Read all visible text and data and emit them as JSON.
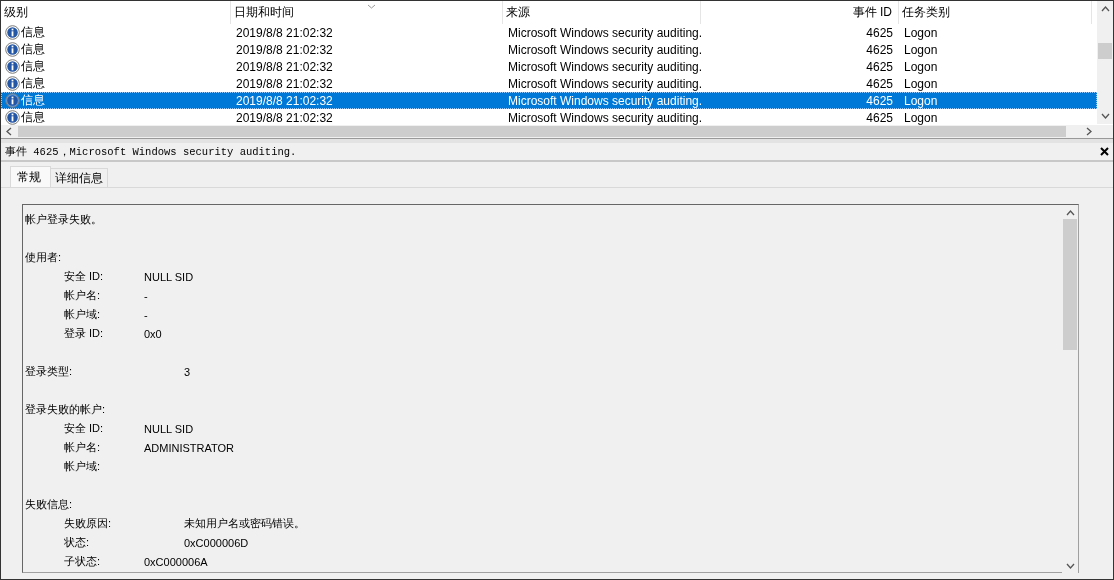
{
  "events": {
    "columns": [
      "级别",
      "日期和时间",
      "来源",
      "事件 ID",
      "任务类别"
    ],
    "rows": [
      {
        "level": "信息",
        "date": "2019/8/8 21:02:32",
        "source": "Microsoft Windows security auditing.",
        "event_id": "4625",
        "category": "Logon",
        "selected": false
      },
      {
        "level": "信息",
        "date": "2019/8/8 21:02:32",
        "source": "Microsoft Windows security auditing.",
        "event_id": "4625",
        "category": "Logon",
        "selected": false
      },
      {
        "level": "信息",
        "date": "2019/8/8 21:02:32",
        "source": "Microsoft Windows security auditing.",
        "event_id": "4625",
        "category": "Logon",
        "selected": false
      },
      {
        "level": "信息",
        "date": "2019/8/8 21:02:32",
        "source": "Microsoft Windows security auditing.",
        "event_id": "4625",
        "category": "Logon",
        "selected": false
      },
      {
        "level": "信息",
        "date": "2019/8/8 21:02:32",
        "source": "Microsoft Windows security auditing.",
        "event_id": "4625",
        "category": "Logon",
        "selected": true
      },
      {
        "level": "信息",
        "date": "2019/8/8 21:02:32",
        "source": "Microsoft Windows security auditing.",
        "event_id": "4625",
        "category": "Logon",
        "selected": false
      }
    ]
  },
  "detail": {
    "title": "事件 4625，Microsoft Windows security auditing.",
    "tabs": [
      {
        "label": "常规",
        "selected": true
      },
      {
        "label": "详细信息",
        "selected": false
      }
    ],
    "lines": [
      {
        "kind": "heading",
        "label": "帐户登录失败。"
      },
      {
        "kind": "blank"
      },
      {
        "kind": "heading",
        "label": "使用者:"
      },
      {
        "kind": "field",
        "label": "安全 ID:",
        "value": "NULL SID"
      },
      {
        "kind": "field",
        "label": "帐户名:",
        "value": "-"
      },
      {
        "kind": "field",
        "label": "帐户域:",
        "value": "-"
      },
      {
        "kind": "field",
        "label": "登录 ID:",
        "value": "0x0"
      },
      {
        "kind": "blank"
      },
      {
        "kind": "heading_field",
        "label": "登录类型:",
        "value": "3"
      },
      {
        "kind": "blank"
      },
      {
        "kind": "heading",
        "label": "登录失败的帐户:"
      },
      {
        "kind": "field",
        "label": "安全 ID:",
        "value": "NULL SID"
      },
      {
        "kind": "field",
        "label": "帐户名:",
        "value": "ADMINISTRATOR"
      },
      {
        "kind": "field",
        "label": "帐户域:"
      },
      {
        "kind": "blank"
      },
      {
        "kind": "heading",
        "label": "失败信息:"
      },
      {
        "kind": "field_far",
        "label": "失败原因:",
        "value": "未知用户名或密码错误。"
      },
      {
        "kind": "field_far",
        "label": "状态:",
        "value": "0xC000006D"
      },
      {
        "kind": "field",
        "label": "子状态:",
        "value": "0xC000006A"
      }
    ]
  }
}
